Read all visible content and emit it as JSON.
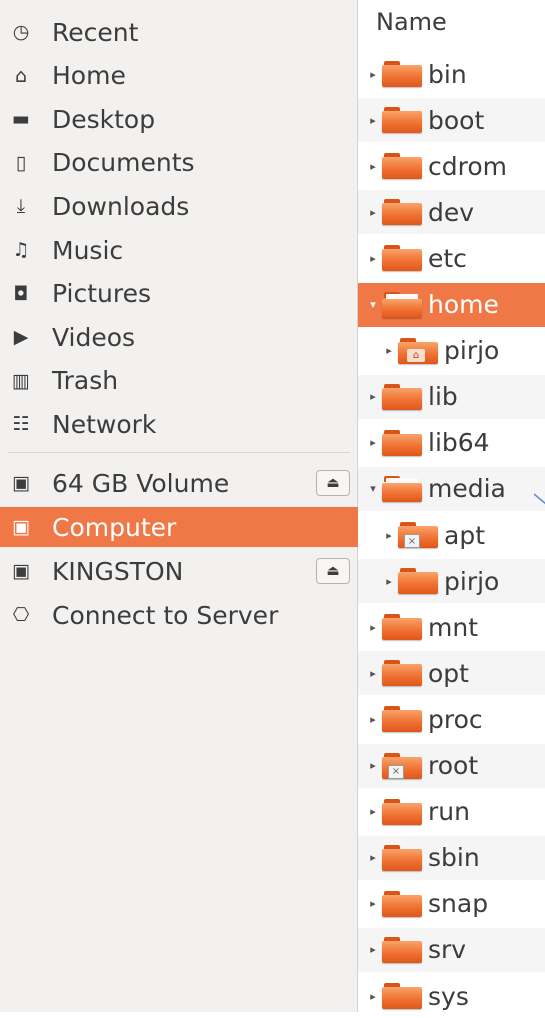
{
  "sidebar": {
    "places": [
      {
        "label": "Recent",
        "icon": "clock-icon"
      },
      {
        "label": "Home",
        "icon": "home-icon"
      },
      {
        "label": "Desktop",
        "icon": "desktop-folder-icon"
      },
      {
        "label": "Documents",
        "icon": "document-icon"
      },
      {
        "label": "Downloads",
        "icon": "download-icon"
      },
      {
        "label": "Music",
        "icon": "music-icon"
      },
      {
        "label": "Pictures",
        "icon": "camera-icon"
      },
      {
        "label": "Videos",
        "icon": "video-icon"
      },
      {
        "label": "Trash",
        "icon": "trash-icon"
      },
      {
        "label": "Network",
        "icon": "network-icon"
      }
    ],
    "devices": [
      {
        "label": "64 GB Volume",
        "icon": "drive-icon",
        "eject": true
      },
      {
        "label": "Computer",
        "icon": "computer-icon",
        "selected": true
      },
      {
        "label": "KINGSTON",
        "icon": "usb-drive-icon",
        "eject": true
      },
      {
        "label": "Connect to Server",
        "icon": "server-icon"
      }
    ],
    "eject_icon": "eject-icon"
  },
  "list": {
    "column_header": "Name",
    "rows": [
      {
        "name": "bin",
        "expander": "collapsed"
      },
      {
        "name": "boot",
        "expander": "collapsed"
      },
      {
        "name": "cdrom",
        "expander": "collapsed"
      },
      {
        "name": "dev",
        "expander": "collapsed"
      },
      {
        "name": "etc",
        "expander": "collapsed"
      },
      {
        "name": "home",
        "expander": "expanded",
        "selected": true
      },
      {
        "name": "pirjo",
        "expander": "collapsed",
        "indent": 1,
        "badge": "home"
      },
      {
        "name": "lib",
        "expander": "collapsed"
      },
      {
        "name": "lib64",
        "expander": "collapsed"
      },
      {
        "name": "media",
        "expander": "expanded"
      },
      {
        "name": "apt",
        "expander": "collapsed",
        "indent": 1,
        "badge": "locked"
      },
      {
        "name": "pirjo",
        "expander": "collapsed",
        "indent": 1
      },
      {
        "name": "mnt",
        "expander": "collapsed"
      },
      {
        "name": "opt",
        "expander": "collapsed"
      },
      {
        "name": "proc",
        "expander": "collapsed"
      },
      {
        "name": "root",
        "expander": "collapsed",
        "badge": "locked"
      },
      {
        "name": "run",
        "expander": "collapsed"
      },
      {
        "name": "sbin",
        "expander": "collapsed"
      },
      {
        "name": "snap",
        "expander": "collapsed"
      },
      {
        "name": "srv",
        "expander": "collapsed"
      },
      {
        "name": "sys",
        "expander": "collapsed"
      }
    ]
  },
  "colors": {
    "accent": "#f07746",
    "sidebar_bg": "#f2f1f0",
    "folder_orange": "#f07131",
    "text": "#3c3c3c"
  }
}
